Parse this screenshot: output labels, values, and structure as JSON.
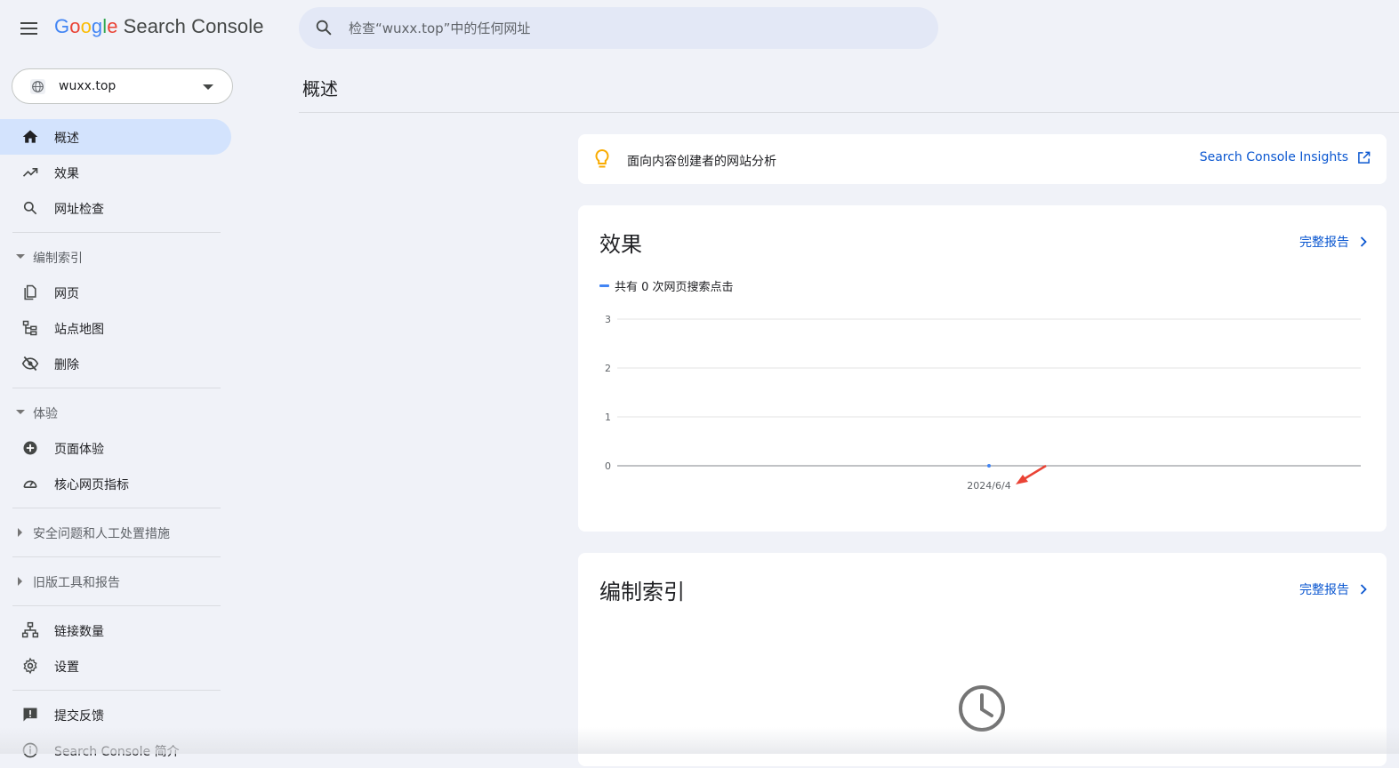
{
  "header": {
    "logo_letters": [
      "G",
      "o",
      "o",
      "g",
      "l",
      "e"
    ],
    "product_name": "Search Console",
    "search_placeholder": "检查“wuxx.top”中的任何网址"
  },
  "property": {
    "name": "wuxx.top"
  },
  "sidebar": {
    "overview": "概述",
    "performance": "效果",
    "url_inspection": "网址检查",
    "indexing_section": "编制索引",
    "pages": "网页",
    "sitemaps": "站点地图",
    "removals": "删除",
    "experience_section": "体验",
    "page_experience": "页面体验",
    "core_web_vitals": "核心网页指标",
    "security_section": "安全问题和人工处置措施",
    "legacy_section": "旧版工具和报告",
    "links": "链接数量",
    "settings": "设置",
    "feedback": "提交反馈",
    "about": "Search Console 简介"
  },
  "main": {
    "page_title": "概述",
    "insights": {
      "text": "面向内容创建者的网站分析",
      "link": "Search Console Insights"
    },
    "performance": {
      "title": "效果",
      "full_report": "完整报告",
      "legend": "共有 0 次网页搜索点击"
    },
    "indexing": {
      "title": "编制索引",
      "full_report": "完整报告"
    }
  },
  "colors": {
    "accent": "#0b57d0",
    "active_nav": "#d3e3fd",
    "series": "#4285f4",
    "annotation_arrow": "#ea4335"
  },
  "chart_data": {
    "type": "line",
    "title": "",
    "xlabel": "",
    "ylabel": "",
    "ylim": [
      0,
      3
    ],
    "y_ticks": [
      "0",
      "1",
      "2",
      "3"
    ],
    "x": [
      "2024/6/4"
    ],
    "series": [
      {
        "name": "共有 0 次网页搜索点击",
        "values": [
          0
        ]
      }
    ],
    "grid": true
  }
}
